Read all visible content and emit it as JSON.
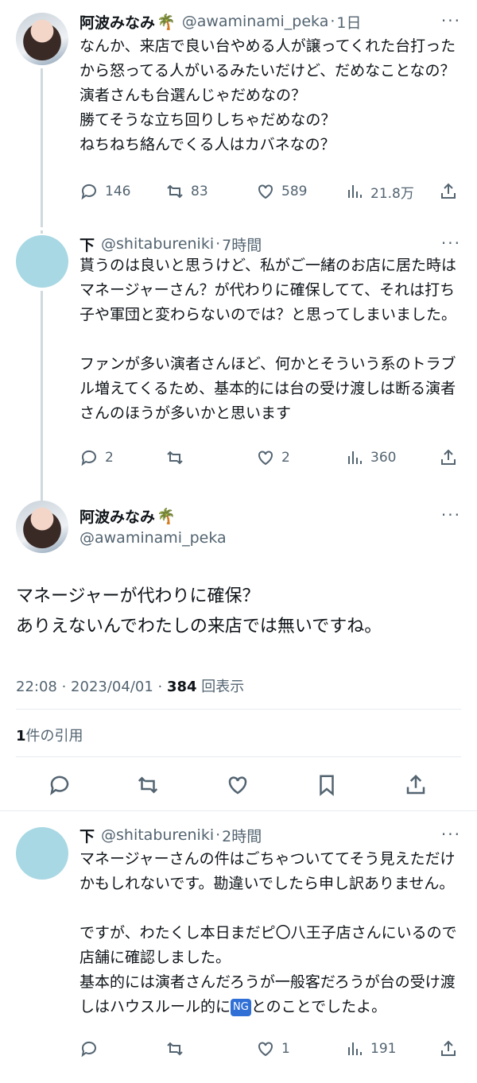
{
  "tweets": [
    {
      "name": "阿波みなみ",
      "palm": "🌴",
      "handle": "@awaminami_peka",
      "time": "1日",
      "text": "なんか、来店で良い台やめる人が譲ってくれた台打ったから怒ってる人がいるみたいだけど、だめなことなの？\n演者さんも台選んじゃだめなの？\n勝てそうな立ち回りしちゃだめなの？\nねちねち絡んでくる人はカバネなの？",
      "replies": "146",
      "retweets": "83",
      "likes": "589",
      "views": "21.8万"
    },
    {
      "name": "下",
      "handle": "@shitabureniki",
      "time": "7時間",
      "text": "貰うのは良いと思うけど、私がご一緒のお店に居た時はマネージャーさん？が代わりに確保してて、それは打ち子や軍団と変わらないのでは？と思ってしまいました。\n\nファンが多い演者さんほど、何かとそういう系のトラブル増えてくるため、基本的には台の受け渡しは断る演者さんのほうが多いかと思います",
      "replies": "2",
      "retweets": "",
      "likes": "2",
      "views": "360"
    }
  ],
  "main": {
    "name": "阿波みなみ",
    "palm": "🌴",
    "handle": "@awaminami_peka",
    "text": "マネージャーが代わりに確保？\nありえないんでわたしの来店では無いですね。",
    "datetime": "22:08 · 2023/04/01 · ",
    "views": "384",
    "views_label": " 回表示",
    "quote_count": "1",
    "quote_label": "件の引用"
  },
  "reply": {
    "name": "下",
    "handle": "@shitabureniki",
    "time": "2時間",
    "text_a": "マネージャーさんの件はごちゃついててそう見えただけかもしれないです。勘違いでしたら申し訳ありません。\n\nですが、わたくし本日まだピ〇八王子店さんにいるので店舗に確認しました。\n基本的には演者さんだろうが一般客だろうが台の受け渡しはハウスルール的に",
    "ng": "NG",
    "text_b": "とのことでしたよ。",
    "replies": "",
    "retweets": "",
    "likes": "1",
    "views": "191"
  },
  "ui": {
    "dot": "·",
    "more": "···"
  }
}
